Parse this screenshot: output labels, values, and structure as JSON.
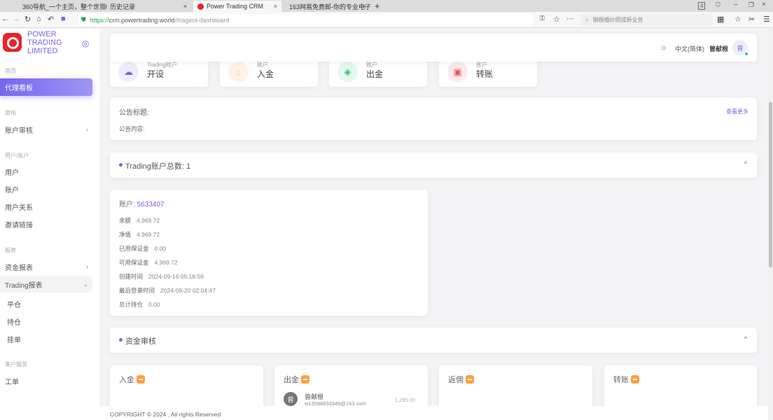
{
  "browser": {
    "tabs": [
      {
        "title": "360导航_一个主页，整个世界"
      },
      {
        "title": "历史记录"
      },
      {
        "title": "Power Trading CRM"
      },
      {
        "title": "163网易免费邮-你的专业电子"
      }
    ],
    "tab_count": "4",
    "url_scheme": "https://",
    "url_host": "crm.powertrading.world",
    "url_path": "/#/agent-dashboard",
    "search_placeholder": "销毁婚纱照成新业务"
  },
  "brand": {
    "name": "POWER TRADING LIMITED"
  },
  "sidebar": {
    "sections": [
      {
        "label": "首页",
        "items": [
          {
            "label": "代理看板",
            "active": true
          }
        ]
      },
      {
        "label": "审核",
        "items": [
          {
            "label": "账户审核",
            "chevron": "›"
          }
        ]
      },
      {
        "label": "用户/账户",
        "items": [
          {
            "label": "用户"
          },
          {
            "label": "账户"
          },
          {
            "label": "用户关系"
          },
          {
            "label": "邀请链接"
          }
        ]
      },
      {
        "label": "报表",
        "items": [
          {
            "label": "资金报表",
            "chevron": "›"
          },
          {
            "label": "Trading报表",
            "chevron": "⌄"
          },
          {
            "label": "平仓"
          },
          {
            "label": "持仓"
          },
          {
            "label": "挂单"
          }
        ]
      },
      {
        "label": "客户服务",
        "items": [
          {
            "label": "工单"
          }
        ]
      }
    ]
  },
  "header": {
    "language": "中文(简体)",
    "username": "曾献根",
    "avatar_initial": "曾"
  },
  "quick_actions": [
    {
      "small": "Trading账户",
      "big": "开设",
      "icon": "cloud-icon",
      "color": "#7367f0"
    },
    {
      "small": "账户",
      "big": "入金",
      "icon": "droplet-icon",
      "color": "#ff9f43"
    },
    {
      "small": "账户",
      "big": "出金",
      "icon": "codepen-icon",
      "color": "#28c76f"
    },
    {
      "small": "账户",
      "big": "转账",
      "icon": "cpu-icon",
      "color": "#ea5455"
    }
  ],
  "announcement": {
    "title_label": "公告标题:",
    "content_label": "公告内容:",
    "more": "查看更多"
  },
  "trading_accounts": {
    "title": "Trading账户总数: 1",
    "account": {
      "label": "账户:",
      "number": "5633407",
      "fields": [
        {
          "k": "余额",
          "v": "4,969.72"
        },
        {
          "k": "净值",
          "v": "4,969.72"
        },
        {
          "k": "已用保证金",
          "v": "0.00"
        },
        {
          "k": "可用保证金",
          "v": "4,969.72"
        },
        {
          "k": "创建时间",
          "v": "2024-09-16 05:18:58"
        },
        {
          "k": "最后登录时间",
          "v": "2024-09-20 02:04:47"
        },
        {
          "k": "总计持仓",
          "v": "0.00"
        }
      ]
    }
  },
  "fund_review": {
    "title": "资金审核",
    "cards": [
      {
        "title": "入金"
      },
      {
        "title": "出金",
        "entry": {
          "initial": "曾",
          "name": "曾献根",
          "email": "w13598833349@163.com",
          "amount": "1,295.00"
        }
      },
      {
        "title": "返佣"
      },
      {
        "title": "转账"
      }
    ]
  },
  "footer": {
    "text": "COPYRIGHT © 2024 , All rights Reserved"
  }
}
